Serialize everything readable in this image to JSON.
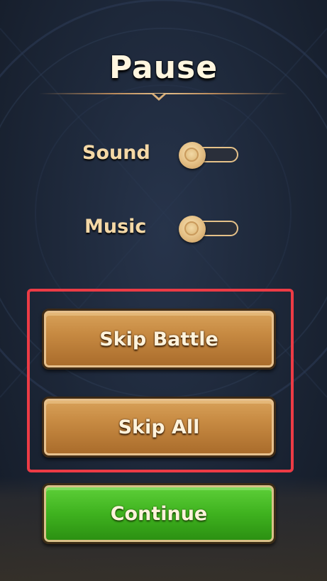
{
  "title": "Pause",
  "settings": {
    "sound": {
      "label": "Sound",
      "enabled": false
    },
    "music": {
      "label": "Music",
      "enabled": false
    }
  },
  "buttons": {
    "skip_battle": "Skip Battle",
    "skip_all": "Skip All",
    "continue": "Continue"
  },
  "colors": {
    "brown_button": "#c78a42",
    "green_button": "#3fb21f",
    "highlight_border": "#ec3b45",
    "label_gold": "#f4d8a6"
  }
}
